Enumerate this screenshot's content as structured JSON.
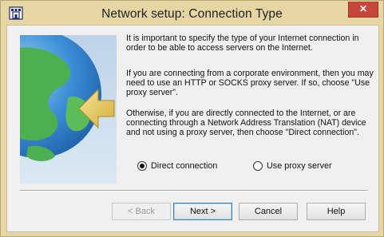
{
  "window": {
    "title": "Network setup: Connection Type",
    "close_glyph": "✕"
  },
  "content": {
    "paragraph_1": "It is important to specify the type of your Internet connection in order to be able to access servers on the Internet.",
    "paragraph_2": "If you are connecting from a corporate environment, then you may need to use an HTTP or SOCKS proxy server. If so, choose \"Use proxy server\".",
    "paragraph_3": "Otherwise, if you are directly connected to the Internet, or are connecting through a Network Address Translation (NAT) device and not using a proxy server, then choose \"Direct connection\"."
  },
  "options": {
    "direct": {
      "label": "Direct connection",
      "checked": true
    },
    "proxy": {
      "label": "Use proxy server",
      "checked": false
    }
  },
  "buttons": {
    "back": "< Back",
    "next": "Next >",
    "cancel": "Cancel",
    "help": "Help"
  },
  "colors": {
    "titlebar": "#e6d6a4",
    "close": "#c7463b",
    "panel_bg": "#f0f0f0",
    "globe_ocean": "#3c8fd6",
    "globe_land": "#4caf50",
    "arrow": "#e8cc5e"
  },
  "icons": {
    "app": "castle-icon",
    "illustration": "globe-arrow-icon"
  }
}
